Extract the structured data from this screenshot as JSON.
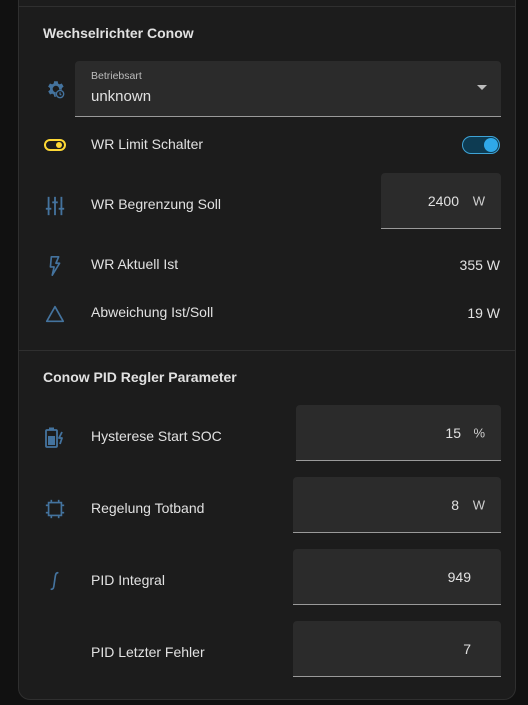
{
  "section1": {
    "title": "Wechselrichter Conow",
    "mode": {
      "label": "Betriebsart",
      "value": "unknown",
      "icon": "cog-clock-icon"
    },
    "limit_switch": {
      "label": "WR Limit Schalter",
      "state": "on",
      "icon": "toggle-switch-icon"
    },
    "limit_target": {
      "label": "WR Begrenzung Soll",
      "value": "2400",
      "unit": "W",
      "icon": "tune-vertical-icon"
    },
    "current": {
      "label": "WR Aktuell Ist",
      "value": "355 W",
      "icon": "flash-outline-icon"
    },
    "deviation": {
      "label": "Abweichung Ist/Soll",
      "value": "19 W",
      "icon": "triangle-outline-icon"
    }
  },
  "section2": {
    "title": "Conow PID Regler Parameter",
    "hysteresis": {
      "label": "Hysterese Start SOC",
      "value": "15",
      "unit": "%",
      "icon": "battery-charging-icon"
    },
    "deadband": {
      "label": "Regelung Totband",
      "value": "8",
      "unit": "W",
      "icon": "selection-ellipse-icon"
    },
    "integral": {
      "label": "PID Integral",
      "value": "949",
      "icon": "integral-icon"
    },
    "last_error": {
      "label": "PID Letzter Fehler",
      "value": "7"
    }
  },
  "colors": {
    "icon": "#44739e",
    "switch_icon": "#fdd835",
    "toggle_active": "#2fa8e8",
    "card_bg": "#1c1c1c",
    "field_bg": "#2b2b2b"
  }
}
